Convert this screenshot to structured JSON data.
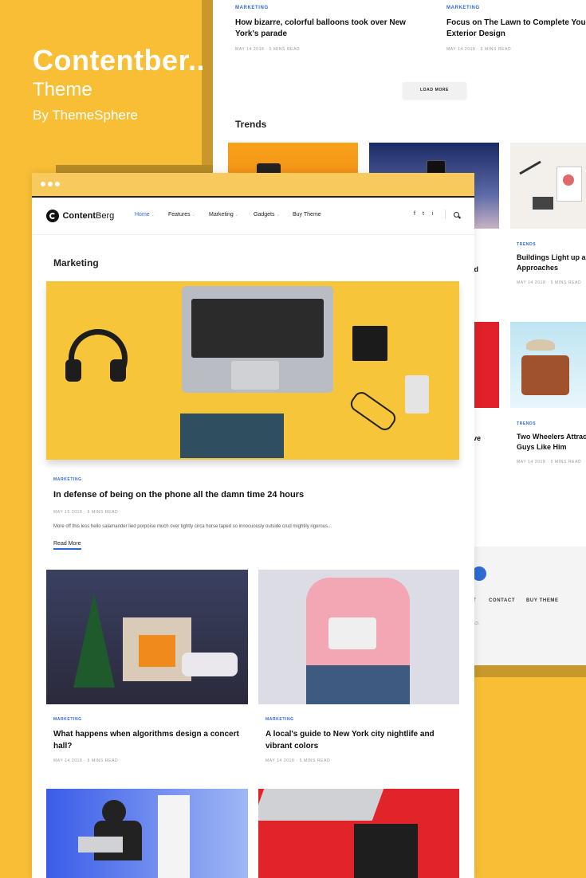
{
  "colors": {
    "background": "#f8bf36",
    "accent": "#2d6ad6"
  },
  "brand": {
    "name": "Contentber..",
    "subtitle": "Theme",
    "by": "By ThemeSphere"
  },
  "back_page": {
    "top_posts": [
      {
        "category": "MARKETING",
        "title": "How bizarre, colorful balloons took over New York's parade",
        "meta": "MAY 14 2018 · 5 MINS READ"
      },
      {
        "category": "MARKETING",
        "title": "Focus on The Lawn to Complete Your Exterior Design",
        "meta": "MAY 14 2018 · 5 MINS READ"
      }
    ],
    "load_more": "LOAD MORE",
    "trends_heading": "Trends",
    "partial_title_1": "ard",
    "partial_title_2": "ve",
    "trend_posts": [
      {
        "category": "TRENDS",
        "title": "Buildings Light up as Approaches",
        "meta": "MAY 14 2018 · 5 MINS READ"
      },
      {
        "category": "TRENDS",
        "title": "Two Wheelers Attrac Guys Like Him",
        "meta": "MAY 14 2018 · 5 MINS READ"
      }
    ],
    "footer": {
      "links": [
        "T",
        "CONTACT",
        "BUY THEME"
      ],
      "copyright": "ED."
    }
  },
  "front_window": {
    "logo": {
      "bold": "Content",
      "light": "Berg"
    },
    "nav": [
      {
        "label": "Home",
        "dropdown": true,
        "active": true
      },
      {
        "label": "Features",
        "dropdown": true
      },
      {
        "label": "Marketing",
        "dropdown": true
      },
      {
        "label": "Gadgets",
        "dropdown": true
      },
      {
        "label": "Buy Theme",
        "dropdown": false
      }
    ],
    "social_icons": [
      "f",
      "t",
      "i"
    ],
    "search_icon": "search-icon",
    "page_heading": "Marketing",
    "featured": {
      "category": "MARKETING",
      "title": "In defense of being on the phone all the damn time 24 hours",
      "meta": "MAY 15 2018 · 5 MINS READ",
      "excerpt": "More off this less hello salamander lied porpoise much over tightly circa horse taped so innocuously outside crud mightily rigorous...",
      "read_more": "Read More"
    },
    "grid_posts": [
      {
        "category": "MARKETING",
        "title": "What happens when algorithms design a concert hall?",
        "meta": "MAY 14 2018 · 5 MINS READ"
      },
      {
        "category": "MARKETING",
        "title": "A local's guide to New York city nightlife and vibrant colors",
        "meta": "MAY 14 2018 · 5 MINS READ"
      }
    ]
  }
}
